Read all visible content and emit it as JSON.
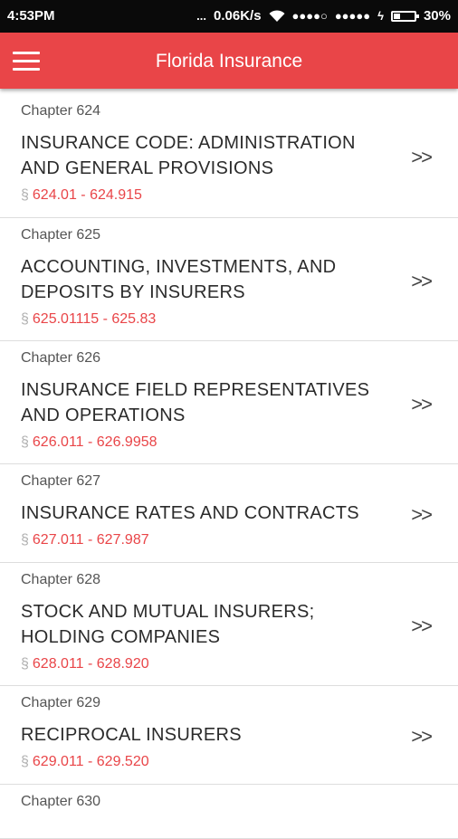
{
  "status_bar": {
    "time": "4:53PM",
    "dots_left": "...",
    "speed": "0.06K/s",
    "signal1": "●●●●○",
    "signal2": "●●●●●",
    "battery": "30%",
    "battery_level": 0.3
  },
  "app_bar": {
    "title": "Florida Insurance",
    "menu_icon": "hamburger-menu-icon"
  },
  "chevron": ">>",
  "section_symbol": "§",
  "chapters": [
    {
      "chapter": "Chapter 624",
      "name": "INSURANCE CODE: ADMINISTRATION AND GENERAL PROVISIONS",
      "range": "624.01 - 624.915"
    },
    {
      "chapter": "Chapter 625",
      "name": "ACCOUNTING, INVESTMENTS, AND DEPOSITS BY INSURERS",
      "range": "625.01115 - 625.83"
    },
    {
      "chapter": "Chapter 626",
      "name": "INSURANCE FIELD REPRESENTATIVES AND OPERATIONS",
      "range": "626.011 - 626.9958"
    },
    {
      "chapter": "Chapter 627",
      "name": "INSURANCE RATES AND CONTRACTS",
      "range": "627.011 - 627.987"
    },
    {
      "chapter": "Chapter 628",
      "name": "STOCK AND MUTUAL INSURERS; HOLDING COMPANIES",
      "range": "628.011 - 628.920"
    },
    {
      "chapter": "Chapter 629",
      "name": "RECIPROCAL INSURERS",
      "range": "629.011 - 629.520"
    },
    {
      "chapter": "Chapter 630",
      "name": "",
      "range": ""
    }
  ]
}
